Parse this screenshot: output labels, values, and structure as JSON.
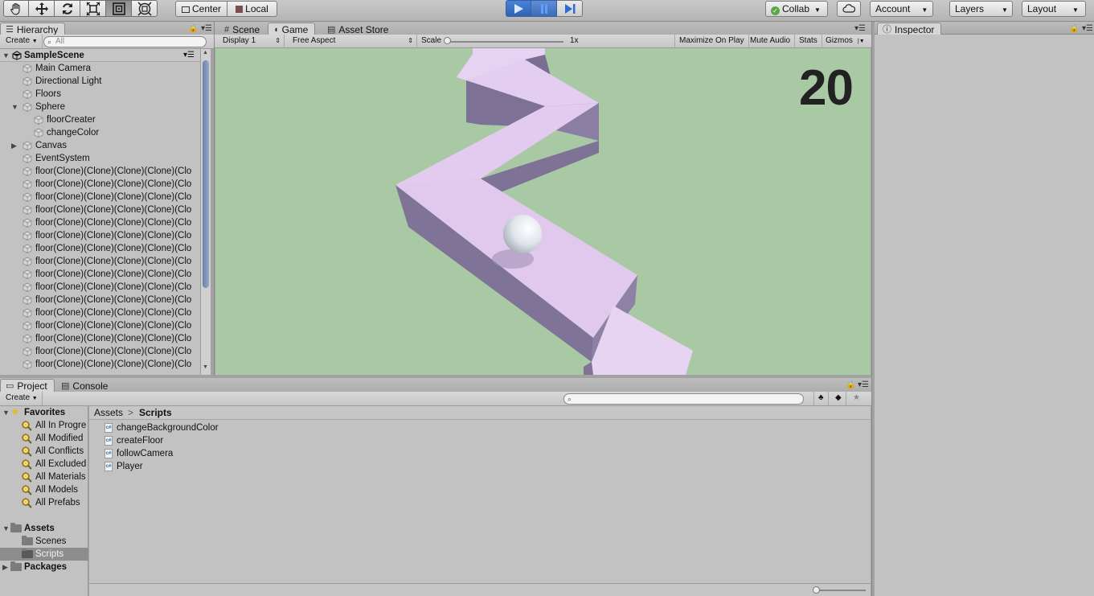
{
  "toolbar": {
    "tools": [
      "hand-tool",
      "move-tool",
      "rotate-tool",
      "scale-tool",
      "rect-tool",
      "transform-tool"
    ],
    "pivot_center": "Center",
    "pivot_local": "Local",
    "collab": "Collab",
    "account": "Account",
    "layers": "Layers",
    "layout": "Layout"
  },
  "hierarchy": {
    "tab": "Hierarchy",
    "create": "Create",
    "search_placeholder": "All",
    "scene": "SampleScene",
    "items": [
      {
        "label": "Main Camera",
        "indent": 1,
        "fold": ""
      },
      {
        "label": "Directional Light",
        "indent": 1,
        "fold": ""
      },
      {
        "label": "Floors",
        "indent": 1,
        "fold": ""
      },
      {
        "label": "Sphere",
        "indent": 1,
        "fold": "open"
      },
      {
        "label": "floorCreater",
        "indent": 2,
        "fold": ""
      },
      {
        "label": "changeColor",
        "indent": 2,
        "fold": ""
      },
      {
        "label": "Canvas",
        "indent": 1,
        "fold": "closed"
      },
      {
        "label": "EventSystem",
        "indent": 1,
        "fold": ""
      },
      {
        "label": "floor(Clone)(Clone)(Clone)(Clone)(Clo",
        "indent": 1,
        "fold": ""
      },
      {
        "label": "floor(Clone)(Clone)(Clone)(Clone)(Clo",
        "indent": 1,
        "fold": ""
      },
      {
        "label": "floor(Clone)(Clone)(Clone)(Clone)(Clo",
        "indent": 1,
        "fold": ""
      },
      {
        "label": "floor(Clone)(Clone)(Clone)(Clone)(Clo",
        "indent": 1,
        "fold": ""
      },
      {
        "label": "floor(Clone)(Clone)(Clone)(Clone)(Clo",
        "indent": 1,
        "fold": ""
      },
      {
        "label": "floor(Clone)(Clone)(Clone)(Clone)(Clo",
        "indent": 1,
        "fold": ""
      },
      {
        "label": "floor(Clone)(Clone)(Clone)(Clone)(Clo",
        "indent": 1,
        "fold": ""
      },
      {
        "label": "floor(Clone)(Clone)(Clone)(Clone)(Clo",
        "indent": 1,
        "fold": ""
      },
      {
        "label": "floor(Clone)(Clone)(Clone)(Clone)(Clo",
        "indent": 1,
        "fold": ""
      },
      {
        "label": "floor(Clone)(Clone)(Clone)(Clone)(Clo",
        "indent": 1,
        "fold": ""
      },
      {
        "label": "floor(Clone)(Clone)(Clone)(Clone)(Clo",
        "indent": 1,
        "fold": ""
      },
      {
        "label": "floor(Clone)(Clone)(Clone)(Clone)(Clo",
        "indent": 1,
        "fold": ""
      },
      {
        "label": "floor(Clone)(Clone)(Clone)(Clone)(Clo",
        "indent": 1,
        "fold": ""
      },
      {
        "label": "floor(Clone)(Clone)(Clone)(Clone)(Clo",
        "indent": 1,
        "fold": ""
      },
      {
        "label": "floor(Clone)(Clone)(Clone)(Clone)(Clo",
        "indent": 1,
        "fold": ""
      },
      {
        "label": "floor(Clone)(Clone)(Clone)(Clone)(Clo",
        "indent": 1,
        "fold": ""
      }
    ]
  },
  "center_tabs": {
    "scene": "Scene",
    "game": "Game",
    "asset_store": "Asset Store"
  },
  "game_bar": {
    "display": "Display 1",
    "aspect": "Free Aspect",
    "scale_label": "Scale",
    "scale_value": "1x",
    "maximize": "Maximize On Play",
    "mute": "Mute Audio",
    "stats": "Stats",
    "gizmos": "Gizmos"
  },
  "game": {
    "score": "20",
    "background_color": "#a8c9a4",
    "path_color": "#e4cbf0"
  },
  "inspector": {
    "tab": "Inspector"
  },
  "project": {
    "tab_project": "Project",
    "tab_console": "Console",
    "create": "Create",
    "favorites": "Favorites",
    "favorite_items": [
      "All In Progre",
      "All Modified",
      "All Conflicts",
      "All Excluded",
      "All Materials",
      "All Models",
      "All Prefabs"
    ],
    "assets": "Assets",
    "asset_folders": [
      "Scenes",
      "Scripts"
    ],
    "packages": "Packages",
    "breadcrumb_root": "Assets",
    "breadcrumb_sep": ">",
    "breadcrumb_current": "Scripts",
    "files": [
      "changeBackgroundColor",
      "createFloor",
      "followCamera",
      "Player"
    ]
  }
}
